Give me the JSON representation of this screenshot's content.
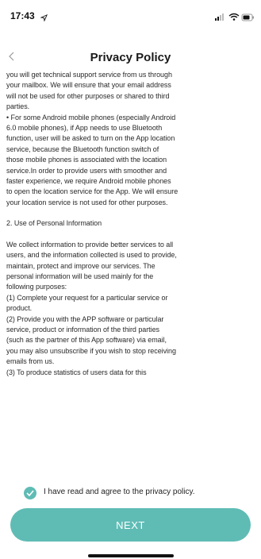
{
  "status_bar": {
    "time": "17:43",
    "icons": [
      "location-arrow-icon",
      "signal-icon",
      "wifi-icon",
      "battery-icon"
    ]
  },
  "nav": {
    "back_icon": "chevron-left-icon",
    "title": "Privacy Policy"
  },
  "policy": {
    "paragraphs": [
      "you will get technical support service from us through\nyour mailbox. We will ensure that your email address\nwill not be used for other purposes or shared to third\nparties.",
      "• For some Android mobile phones (especially Android\n6.0 mobile phones), if App needs to use Bluetooth\nfunction, user will be asked to turn on the App location\nservice, because the Bluetooth function switch of\nthose mobile phones is associated with the location\nservice.In order to provide users with smoother and\nfaster experience, we require Android mobile phones\nto open the location service for the App. We will ensure\nyour location service is not used for other purposes."
    ],
    "section_heading": "2. Use of Personal Information",
    "section_paragraphs": [
      "We collect information to provide better services to all\nusers, and the information collected is used to provide,\nmaintain, protect and improve our services. The\npersonal information will be used mainly for the\nfollowing purposes:\n(1) Complete your request for a particular service or\nproduct.\n(2) Provide you with the APP software or particular\nservice, product or information of the third parties\n(such as the partner of this App software) via email,\nyou may also unsubscribe if you wish to stop receiving\nemails from us.\n(3) To produce statistics of users data for this"
    ]
  },
  "agree": {
    "checked": true,
    "label": "I have read and agree to the privacy policy."
  },
  "next_button": {
    "label": "NEXT"
  },
  "colors": {
    "accent": "#5fbcb5",
    "text": "#2a2a2a",
    "background": "#ffffff"
  }
}
